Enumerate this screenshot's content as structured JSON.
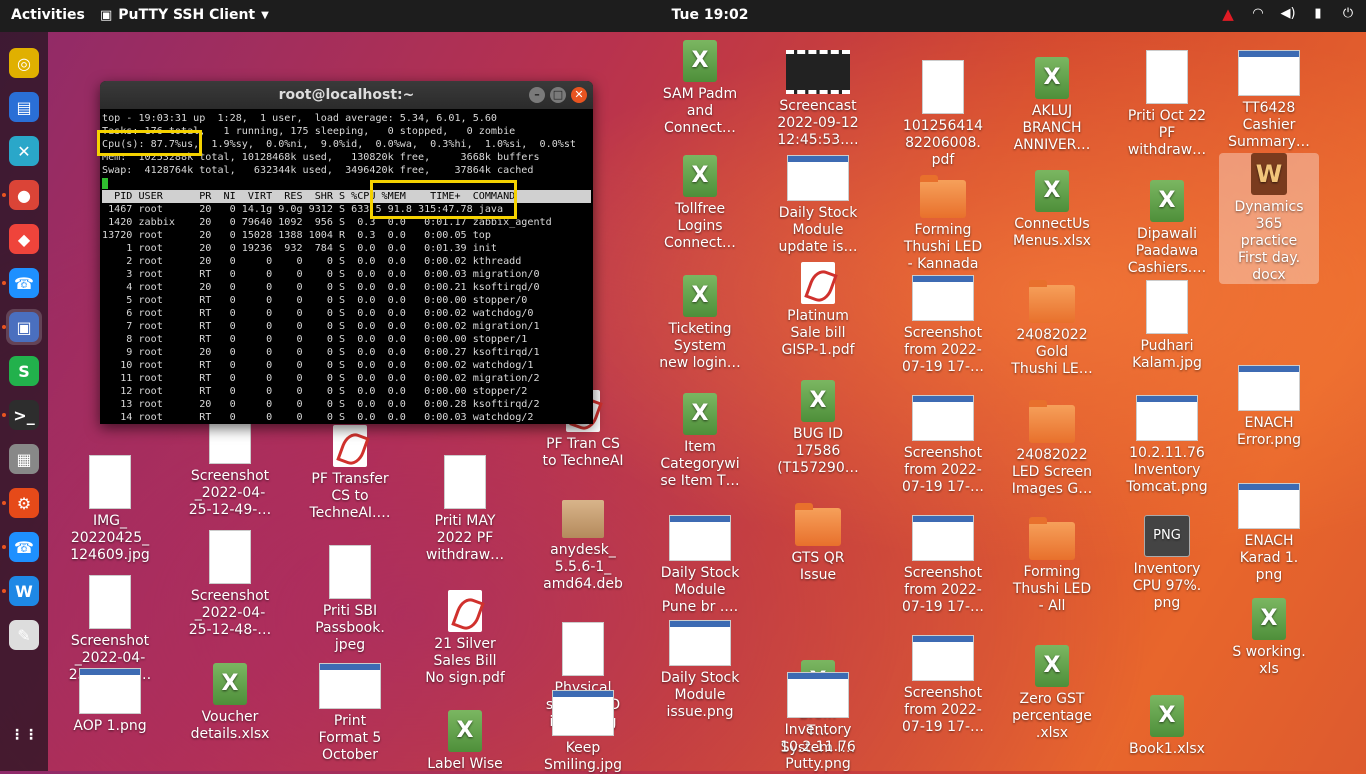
{
  "topbar": {
    "activities": "Activities",
    "app_name": "PuTTY SSH Client",
    "clock": "Tue 19:02",
    "tray": [
      "warning-icon",
      "network-icon",
      "volume-icon",
      "battery-icon",
      "power-icon"
    ]
  },
  "dock": {
    "items": [
      {
        "name": "rhythmbox",
        "glyph": "◎",
        "color": "#e0b000"
      },
      {
        "name": "libreoffice-writer",
        "glyph": "▤",
        "color": "#2a6fd6"
      },
      {
        "name": "crossover",
        "glyph": "✕",
        "color": "#2aa7c9"
      },
      {
        "name": "chrome",
        "glyph": "●",
        "color": "#db4437"
      },
      {
        "name": "anydesk",
        "glyph": "◆",
        "color": "#ef443b"
      },
      {
        "name": "phone",
        "glyph": "☎",
        "color": "#1e90ff"
      },
      {
        "name": "putty",
        "glyph": "▣",
        "color": "#4a6fbf"
      },
      {
        "name": "s-app",
        "glyph": "S",
        "color": "#22b14c"
      },
      {
        "name": "terminal",
        "glyph": ">_",
        "color": "#2d2d2d"
      },
      {
        "name": "calculator",
        "glyph": "▦",
        "color": "#888888"
      },
      {
        "name": "settings",
        "glyph": "⚙",
        "color": "#e64a19"
      },
      {
        "name": "phone-2",
        "glyph": "☎",
        "color": "#1e90ff"
      },
      {
        "name": "w-app",
        "glyph": "W",
        "color": "#1e88e5"
      },
      {
        "name": "pen-tool",
        "glyph": "✎",
        "color": "#dddddd"
      },
      {
        "name": "show-apps",
        "glyph": "⋮⋮",
        "color": "#ffffff"
      }
    ]
  },
  "terminal": {
    "title": "root@localhost:~",
    "lines": [
      "top - 19:03:31 up  1:28,  1 user,  load average: 5.34, 6.01, 5.60",
      "Tasks: 176 total,   1 running, 175 sleeping,   0 stopped,   0 zombie",
      "Cpu(s): 87.7%us,  1.9%sy,  0.0%ni,  9.0%id,  0.0%wa,  0.3%hi,  1.0%si,  0.0%st",
      "Mem:  10253288k total, 10128468k used,   130820k free,     3668k buffers",
      "Swap:  4128764k total,   632344k used,  3496420k free,    37864k cached"
    ],
    "header": "  PID USER      PR  NI  VIRT  RES  SHR S %CPU %MEM    TIME+  COMMAND",
    "rows": [
      " 1467 root      20   0 14.1g 9.0g 9312 S 633.5 91.8 315:47.78 java",
      " 1420 zabbix    20   0 79640 1092  956 S  0.3  0.0   0:01.17 zabbix_agentd",
      "13720 root      20   0 15028 1388 1004 R  0.3  0.0   0:00.05 top",
      "    1 root      20   0 19236  932  784 S  0.0  0.0   0:01.39 init",
      "    2 root      20   0     0    0    0 S  0.0  0.0   0:00.02 kthreadd",
      "    3 root      RT   0     0    0    0 S  0.0  0.0   0:00.03 migration/0",
      "    4 root      20   0     0    0    0 S  0.0  0.0   0:00.21 ksoftirqd/0",
      "    5 root      RT   0     0    0    0 S  0.0  0.0   0:00.00 stopper/0",
      "    6 root      RT   0     0    0    0 S  0.0  0.0   0:00.02 watchdog/0",
      "    7 root      RT   0     0    0    0 S  0.0  0.0   0:00.02 migration/1",
      "    8 root      RT   0     0    0    0 S  0.0  0.0   0:00.00 stopper/1",
      "    9 root      20   0     0    0    0 S  0.0  0.0   0:00.27 ksoftirqd/1",
      "   10 root      RT   0     0    0    0 S  0.0  0.0   0:00.02 watchdog/1",
      "   11 root      RT   0     0    0    0 S  0.0  0.0   0:00.02 migration/2",
      "   12 root      RT   0     0    0    0 S  0.0  0.0   0:00.00 stopper/2",
      "   13 root      20   0     0    0    0 S  0.0  0.0   0:00.28 ksoftirqd/2",
      "   14 root      RT   0     0    0    0 S  0.0  0.0   0:00.03 watchdog/2"
    ]
  },
  "desktop": {
    "col1": [
      {
        "kind": "doc",
        "label": "IMG_\n20220425_\n124609.jpg"
      },
      {
        "kind": "doc",
        "label": "Screenshot\n_2022-04-\n25-12-52-…"
      },
      {
        "kind": "png",
        "label": "AOP 1.png"
      }
    ],
    "col2": [
      {
        "kind": "doc",
        "label": "Screenshot\n_2022-04-\n25-12-49-…"
      },
      {
        "kind": "doc",
        "label": "Screenshot\n_2022-04-\n25-12-48-…"
      },
      {
        "kind": "xls",
        "label": "Voucher\ndetails.xlsx"
      }
    ],
    "col3": [
      {
        "kind": "pdf",
        "label": "PF Transfer\nCS to\nTechneAI.…"
      },
      {
        "kind": "doc",
        "label": "Priti SBI\nPassbook.\njpeg"
      },
      {
        "kind": "png",
        "label": "Print\nFormat 5\nOctober"
      }
    ],
    "col4": [
      {
        "kind": "doc",
        "label": "Priti MAY\n2022 PF\nwithdraw…"
      },
      {
        "kind": "pdf",
        "label": "21 Silver\nSales Bill\nNo sign.pdf"
      },
      {
        "kind": "xls",
        "label": "Label Wise"
      }
    ],
    "col5": [
      {
        "kind": "pdf",
        "label": "PF Tran CS\nto TechneAI"
      },
      {
        "kind": "box",
        "label": "anydesk_\n5.5.6-1_\namd64.deb"
      },
      {
        "kind": "doc",
        "label": "Physical\nstock RFID\nissue.png"
      },
      {
        "kind": "png",
        "label": "Keep\nSmiling.jpg"
      }
    ],
    "col6": [
      {
        "kind": "xls",
        "label": "SAM Padm\nand\nConnect…"
      },
      {
        "kind": "xls",
        "label": "Tollfree\nLogins\nConnect…"
      },
      {
        "kind": "xls",
        "label": "Ticketing\nSystem\nnew login…"
      },
      {
        "kind": "xls",
        "label": "Item\nCategorywi\nse Item T…"
      },
      {
        "kind": "png",
        "label": "Daily Stock\nModule\nPune br .…"
      },
      {
        "kind": "png",
        "label": "Daily Stock\nModule\nissue.png"
      }
    ],
    "col7": [
      {
        "kind": "film",
        "label": "Screencast\n2022-09-12\n12:45:53.…"
      },
      {
        "kind": "png",
        "label": "Daily Stock\nModule\nupdate is…"
      },
      {
        "kind": "pdf",
        "label": "Platinum\nSale bill\nGISP-1.pdf"
      },
      {
        "kind": "xls",
        "label": "BUG ID\n17586\n(T157290…"
      },
      {
        "kind": "folder",
        "label": "GTS QR\nIssue"
      },
      {
        "kind": "xls",
        "label": "Bro…\nT…\nSystem l…"
      },
      {
        "kind": "png",
        "label": "Inventory\n10.2.11.76\nPutty.png"
      }
    ],
    "col8": [
      {
        "kind": "doc",
        "label": "101256414\n82206008.\npdf"
      },
      {
        "kind": "folder",
        "label": "Forming\nThushi LED\n- Kannada"
      },
      {
        "kind": "png",
        "label": "Screenshot\nfrom 2022-\n07-19 17-…"
      },
      {
        "kind": "png",
        "label": "Screenshot\nfrom 2022-\n07-19 17-…"
      },
      {
        "kind": "png",
        "label": "Screenshot\nfrom 2022-\n07-19 17-…"
      },
      {
        "kind": "png",
        "label": "Screenshot\nfrom 2022-\n07-19 17-…"
      }
    ],
    "col9": [
      {
        "kind": "xls",
        "label": "AKLUJ\nBRANCH\nANNIVER…"
      },
      {
        "kind": "xls",
        "label": "ConnectUs\nMenus.xlsx"
      },
      {
        "kind": "folder",
        "label": "24082022\nGold\nThushi LE…"
      },
      {
        "kind": "folder",
        "label": "24082022\nLED Screen\nImages G…"
      },
      {
        "kind": "folder",
        "label": "Forming\nThushi LED\n- All"
      },
      {
        "kind": "xls",
        "label": "Zero GST\npercentage\n.xlsx"
      }
    ],
    "col10": [
      {
        "kind": "doc",
        "label": "Priti Oct 22\nPF\nwithdraw…"
      },
      {
        "kind": "xls",
        "label": "Dipawali\nPaadawa\nCashiers.…"
      },
      {
        "kind": "doc",
        "label": "Pudhari\nKalam.jpg"
      },
      {
        "kind": "png",
        "label": "10.2.11.76\nInventory\nTomcat.png"
      },
      {
        "kind": "pngtag",
        "label": "Inventory\nCPU 97%.\npng"
      },
      {
        "kind": "xls",
        "label": "Book1.xlsx"
      }
    ],
    "col11": [
      {
        "kind": "png",
        "label": "TT6428\nCashier\nSummary…"
      },
      {
        "kind": "wd",
        "label": "Dynamics\n365\npractice\nFirst day.\ndocx"
      },
      {
        "kind": "png",
        "label": "ENACH\nError.png"
      },
      {
        "kind": "png",
        "label": "ENACH\nKarad 1.\npng"
      },
      {
        "kind": "xls",
        "label": "S working.\nxls"
      }
    ]
  }
}
